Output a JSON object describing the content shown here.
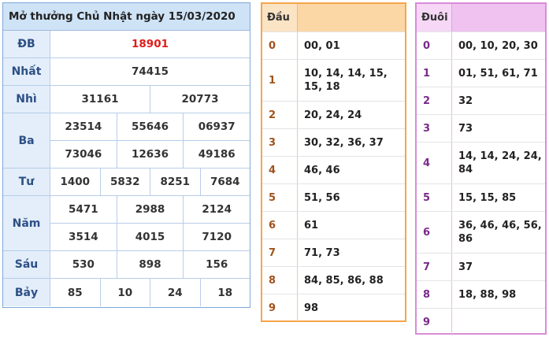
{
  "results": {
    "title": "Mở thưởng Chủ Nhật ngày 15/03/2020",
    "prizes": [
      {
        "label": "ĐB",
        "rows": [
          [
            "18901"
          ]
        ]
      },
      {
        "label": "Nhất",
        "rows": [
          [
            "74415"
          ]
        ]
      },
      {
        "label": "Nhì",
        "rows": [
          [
            "31161",
            "20773"
          ]
        ]
      },
      {
        "label": "Ba",
        "rows": [
          [
            "23514",
            "55646",
            "06937"
          ],
          [
            "73046",
            "12636",
            "49186"
          ]
        ]
      },
      {
        "label": "Tư",
        "rows": [
          [
            "1400",
            "5832",
            "8251",
            "7684"
          ]
        ]
      },
      {
        "label": "Năm",
        "rows": [
          [
            "5471",
            "2988",
            "2124"
          ],
          [
            "3514",
            "4015",
            "7120"
          ]
        ]
      },
      {
        "label": "Sáu",
        "rows": [
          [
            "530",
            "898",
            "156"
          ]
        ]
      },
      {
        "label": "Bảy",
        "rows": [
          [
            "85",
            "10",
            "24",
            "18"
          ]
        ]
      }
    ]
  },
  "dau": {
    "header": "Đầu",
    "rows": [
      {
        "digit": "0",
        "values": "00, 01"
      },
      {
        "digit": "1",
        "values": "10, 14, 14, 15, 15, 18"
      },
      {
        "digit": "2",
        "values": "20, 24, 24"
      },
      {
        "digit": "3",
        "values": "30, 32, 36, 37"
      },
      {
        "digit": "4",
        "values": "46, 46"
      },
      {
        "digit": "5",
        "values": "51, 56"
      },
      {
        "digit": "6",
        "values": "61"
      },
      {
        "digit": "7",
        "values": "71, 73"
      },
      {
        "digit": "8",
        "values": "84, 85, 86, 88"
      },
      {
        "digit": "9",
        "values": "98"
      }
    ]
  },
  "duoi": {
    "header": "Đuôi",
    "rows": [
      {
        "digit": "0",
        "values": "00, 10, 20, 30"
      },
      {
        "digit": "1",
        "values": "01, 51, 61, 71"
      },
      {
        "digit": "2",
        "values": "32"
      },
      {
        "digit": "3",
        "values": "73"
      },
      {
        "digit": "4",
        "values": "14, 14, 24, 24, 84"
      },
      {
        "digit": "5",
        "values": "15, 15, 85"
      },
      {
        "digit": "6",
        "values": "36, 46, 46, 56, 86"
      },
      {
        "digit": "7",
        "values": "37"
      },
      {
        "digit": "8",
        "values": "18, 88, 98"
      },
      {
        "digit": "9",
        "values": ""
      }
    ]
  }
}
